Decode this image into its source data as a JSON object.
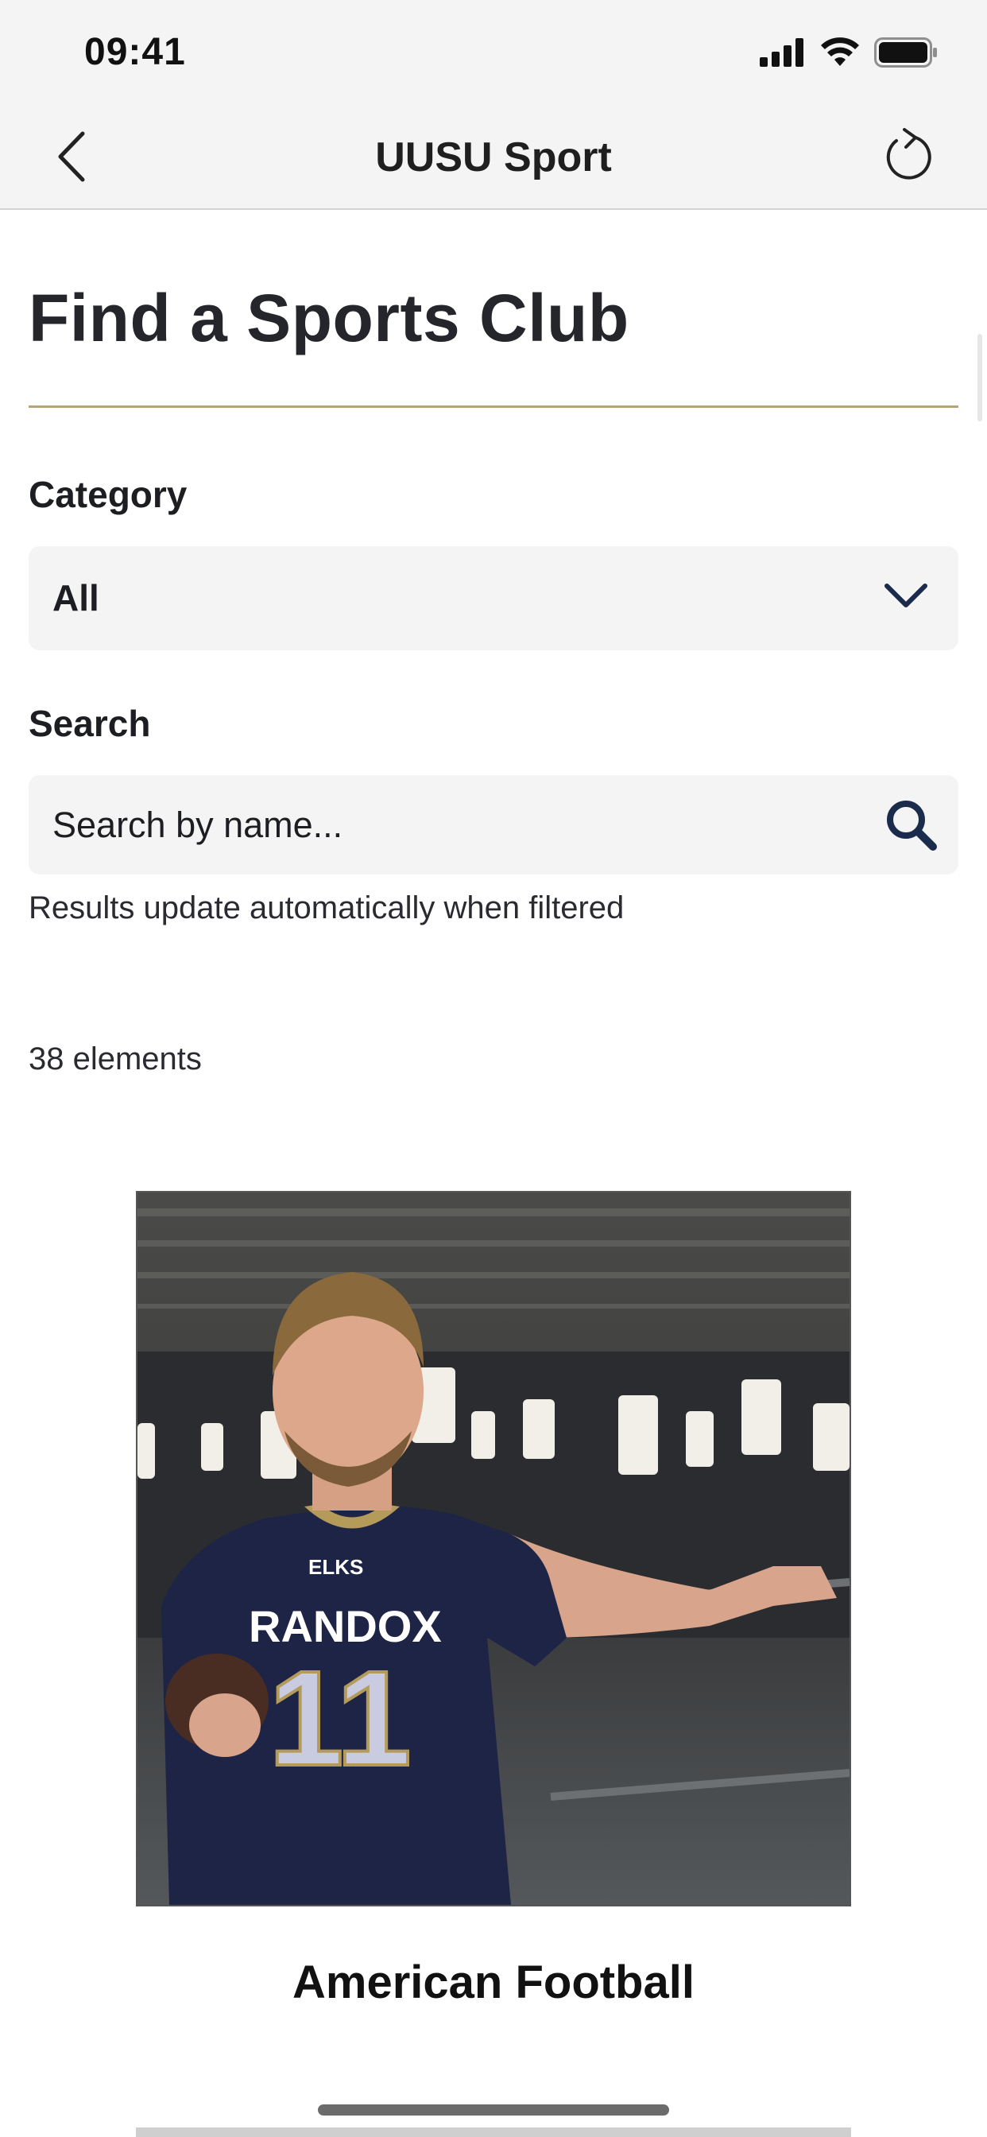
{
  "status_bar": {
    "time": "09:41"
  },
  "nav": {
    "title": "UUSU Sport"
  },
  "page": {
    "title": "Find a Sports Club"
  },
  "filters": {
    "category_label": "Category",
    "category_value": "All",
    "search_label": "Search",
    "search_placeholder": "Search by name...",
    "hint": "Results update automatically when filtered"
  },
  "results": {
    "count_text": "38 elements",
    "clubs": [
      {
        "name": "American Football"
      }
    ]
  },
  "colors": {
    "accent_rule": "#b5a678",
    "icon_navy": "#1a2b4c",
    "field_bg": "#f4f4f4",
    "header_bg": "#f4f4f4"
  },
  "icons": {
    "back": "chevron-left-icon",
    "refresh": "refresh-icon",
    "dropdown": "chevron-down-icon",
    "search": "search-icon"
  }
}
